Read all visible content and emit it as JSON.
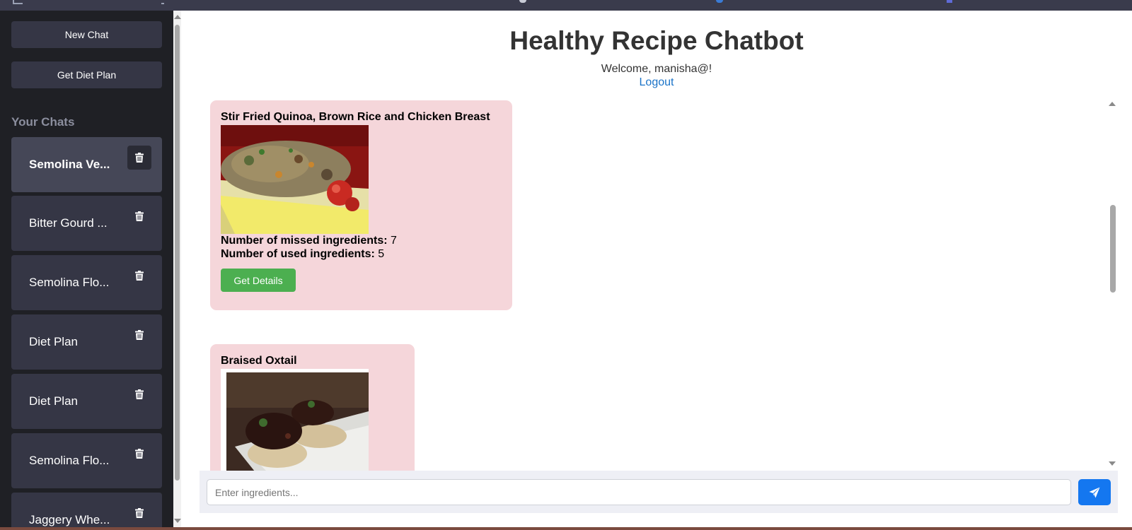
{
  "sidebar": {
    "new_chat_label": "New Chat",
    "diet_plan_label": "Get Diet Plan",
    "chats_heading": "Your Chats",
    "chats": [
      {
        "label": "Semolina Ve...",
        "active": true
      },
      {
        "label": "Bitter Gourd ...",
        "active": false
      },
      {
        "label": "Semolina Flo...",
        "active": false
      },
      {
        "label": "Diet Plan",
        "active": false
      },
      {
        "label": "Diet Plan",
        "active": false
      },
      {
        "label": "Semolina Flo...",
        "active": false
      },
      {
        "label": "Jaggery Whe...",
        "active": false
      }
    ]
  },
  "header": {
    "title": "Healthy Recipe Chatbot",
    "welcome": "Welcome, manisha@!",
    "logout": "Logout"
  },
  "recipes": [
    {
      "title": "Stir Fried Quinoa, Brown Rice and Chicken Breast",
      "missed_label": "Number of missed ingredients:",
      "missed_value": "7",
      "used_label": "Number of used ingredients:",
      "used_value": "5",
      "button": "Get Details"
    },
    {
      "title": "Braised Oxtail"
    }
  ],
  "composer": {
    "placeholder": "Enter ingredients..."
  },
  "colors": {
    "sidebar_bg": "#1f2025",
    "sidebar_button": "#353645",
    "card_bg": "#f5d6da",
    "details_button": "#4caf50",
    "send_button": "#1477f0",
    "logout_link": "#1a73c8"
  }
}
